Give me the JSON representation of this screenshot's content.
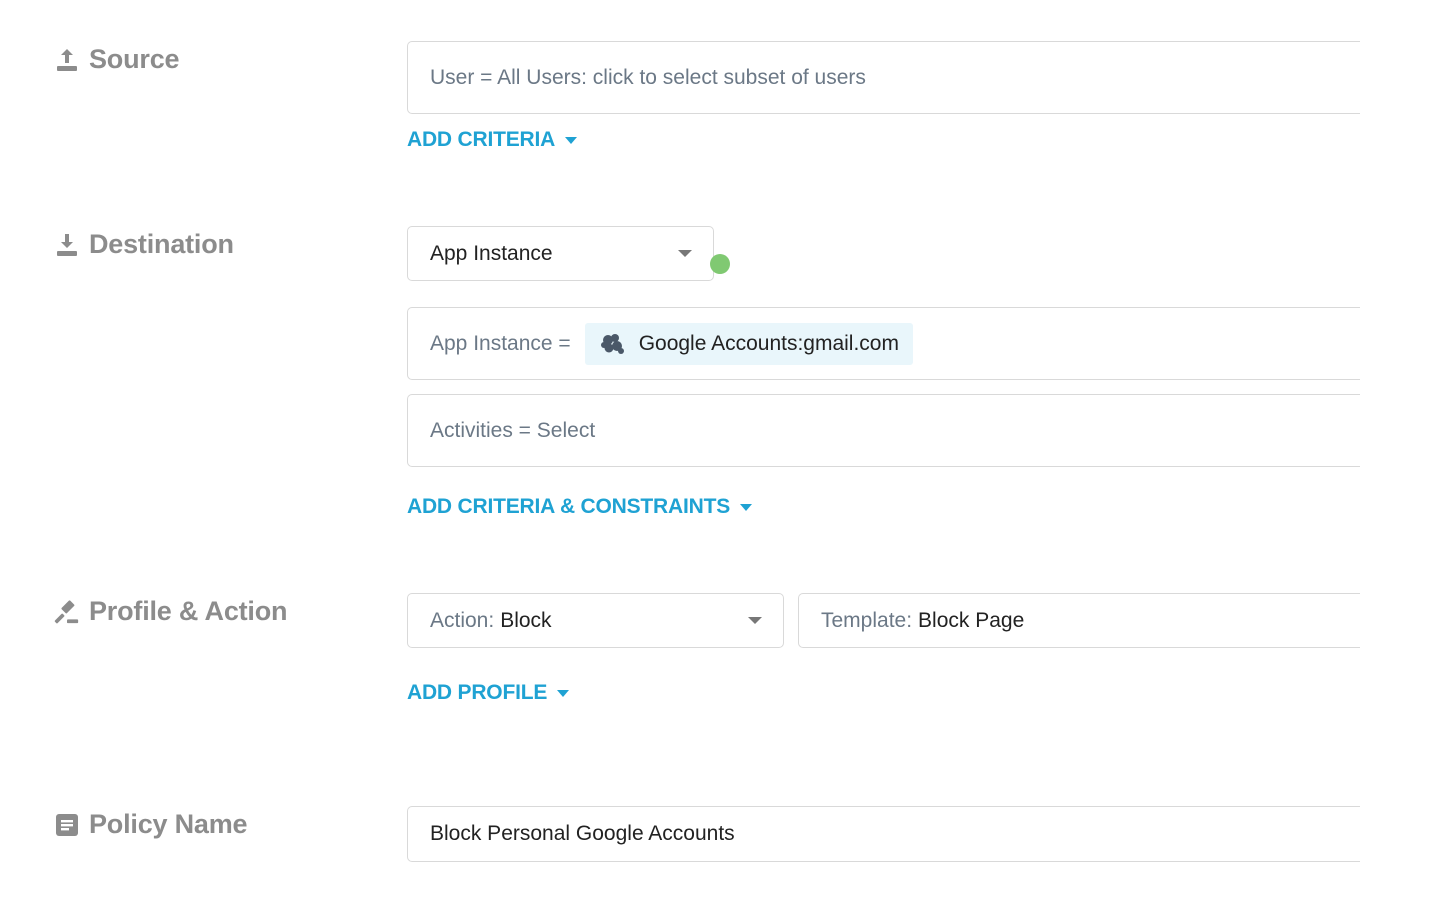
{
  "source": {
    "label": "Source",
    "icon": "upload-icon",
    "user_field": "User = All Users: click to select subset of users",
    "add_criteria": "ADD CRITERIA"
  },
  "destination": {
    "label": "Destination",
    "icon": "download-icon",
    "type_select": "App Instance",
    "app_instance_prefix": "App Instance =",
    "app_instance_value": "Google Accounts:gmail.com",
    "activities_field": "Activities = Select",
    "add_criteria": "ADD CRITERIA & CONSTRAINTS"
  },
  "profile_action": {
    "label": "Profile & Action",
    "icon": "gavel-icon",
    "action_prefix": "Action:",
    "action_value": "Block",
    "template_prefix": "Template:",
    "template_value": "Block Page",
    "add_profile": "ADD PROFILE"
  },
  "policy_name": {
    "label": "Policy Name",
    "icon": "document-icon",
    "value": "Block Personal Google Accounts"
  },
  "colors": {
    "accent": "#1fa2d3",
    "label_gray": "#8c8c8c",
    "status_green": "#80c972",
    "chip_bg": "#e9f6fb"
  }
}
